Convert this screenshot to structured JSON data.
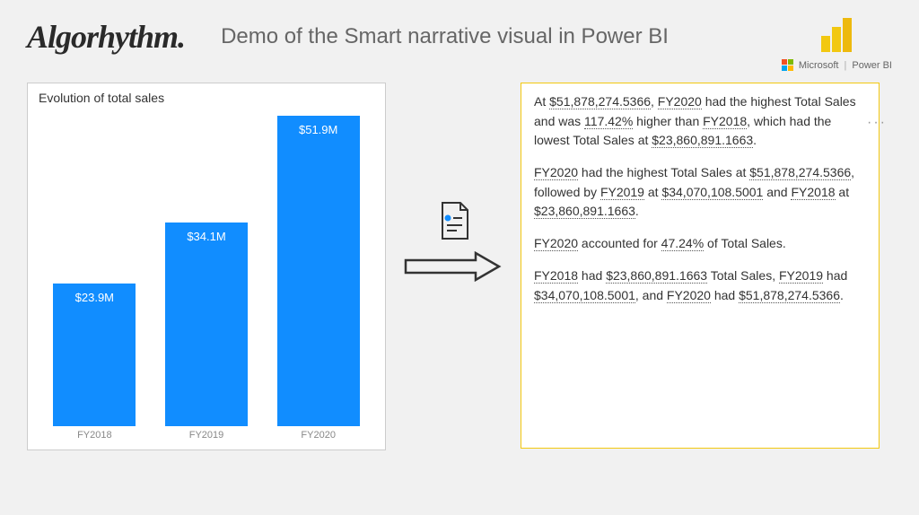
{
  "header": {
    "logo_text": "Algorhythm.",
    "title": "Demo of the Smart narrative visual in Power BI"
  },
  "branding": {
    "microsoft": "Microsoft",
    "powerbi": "Power BI"
  },
  "chart_data": {
    "type": "bar",
    "title": "Evolution of total sales",
    "categories": [
      "FY2018",
      "FY2019",
      "FY2020"
    ],
    "values": [
      23900000,
      34100000,
      51900000
    ],
    "display_labels": [
      "$23.9M",
      "$34.1M",
      "$51.9M"
    ],
    "xlabel": "",
    "ylabel": "",
    "ylim": [
      0,
      55000000
    ]
  },
  "narrative": {
    "p1_pre": "At ",
    "v_highest_sales": "$51,878,274.5366",
    "p1_mid1": ", ",
    "v_fy2020": "FY2020",
    "p1_mid2": " had the highest Total Sales and was ",
    "v_pct_higher": "117.42%",
    "p1_mid3": " higher than ",
    "v_fy2018": "FY2018",
    "p1_mid4": ", which had the lowest Total Sales at ",
    "v_lowest_sales": "$23,860,891.1663",
    "p1_end": ".",
    "p2_a": " had the highest Total Sales at ",
    "p2_b": ", followed by ",
    "v_fy2019": "FY2019",
    "p2_c": " at ",
    "v_mid_sales": "$34,070,108.5001",
    "p2_d": " and ",
    "p2_e": " at ",
    "p3_a": " accounted for ",
    "v_share": "47.24%",
    "p3_b": " of Total Sales.",
    "p4_a": " had ",
    "p4_b": " Total Sales, ",
    "p4_c": " had ",
    "p4_d": ", and ",
    "p4_e": " had ",
    "dots": "···"
  }
}
